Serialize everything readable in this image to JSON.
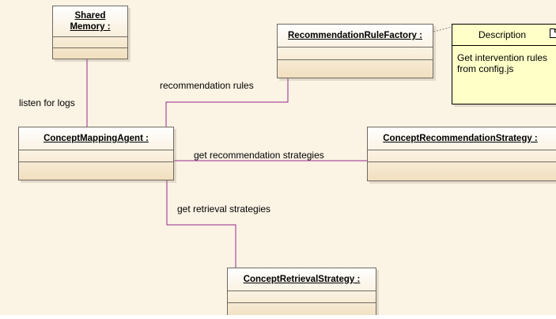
{
  "classes": {
    "shared_memory": {
      "line1": "Shared",
      "line2": "Memory :"
    },
    "rule_factory": {
      "name": "RecommendationRuleFactory :"
    },
    "agent": {
      "name": "ConceptMappingAgent :"
    },
    "recommendation_strategy": {
      "name": "ConceptRecommendationStrategy :"
    },
    "retrieval_strategy": {
      "name": "ConceptRetrievalStrategy :"
    }
  },
  "note": {
    "title": "Description",
    "line1": "Get intervention rules",
    "line2": "from config.js"
  },
  "links": {
    "listen": "listen for logs",
    "rules": "recommendation rules",
    "recommendation": "get recommendation strategies",
    "retrieval": "get retrieval strategies"
  },
  "colors": {
    "connector": "#99298f",
    "note_fill": "#ffffc8",
    "class_fill": "#f6e8cc",
    "canvas": "#fbf3e4"
  }
}
